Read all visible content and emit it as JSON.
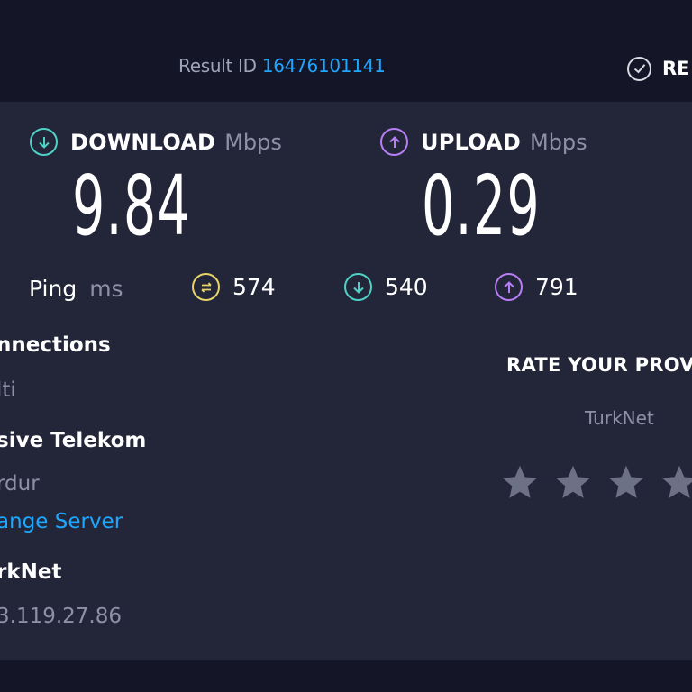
{
  "header": {
    "result_label": "Result ID",
    "result_id": "16476101141",
    "results_label": "RE"
  },
  "download": {
    "title": "DOWNLOAD",
    "unit": "Mbps",
    "value": "9.84",
    "icon": "download-arrow-icon",
    "color": "#4fd1c5"
  },
  "upload": {
    "title": "UPLOAD",
    "unit": "Mbps",
    "value": "0.29",
    "icon": "upload-arrow-icon",
    "color": "#b77ef5"
  },
  "ping": {
    "label": "Ping",
    "unit": "ms",
    "idle": {
      "value": "574",
      "icon": "idle-ping-icon",
      "color": "#e6d46a"
    },
    "download": {
      "value": "540",
      "icon": "download-ping-icon",
      "color": "#4fd1c5"
    },
    "upload": {
      "value": "791",
      "icon": "upload-ping-icon",
      "color": "#b77ef5"
    }
  },
  "details": {
    "connections_title": "nnections",
    "connections_value": "lti",
    "server_name": "sive Telekom",
    "server_location": "rdur",
    "change_server": "ange Server",
    "provider_name": "rkNet",
    "ip_address": "3.119.27.86"
  },
  "rating": {
    "title": "RATE YOUR PROV",
    "provider": "TurkNet",
    "stars": 4,
    "star_color": "#6c7186"
  },
  "colors": {
    "background": "#141526",
    "panel": "#232638",
    "accent_link": "#1ea7ff"
  }
}
